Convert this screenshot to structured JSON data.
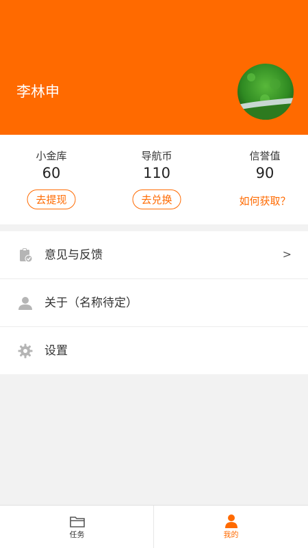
{
  "profile": {
    "name": "李林申"
  },
  "stats": [
    {
      "label": "小金库",
      "value": "60",
      "action": "去提现"
    },
    {
      "label": "导航币",
      "value": "110",
      "action": "去兑换"
    },
    {
      "label": "信誉值",
      "value": "90",
      "action": "如何获取？"
    }
  ],
  "menu": [
    {
      "label": "意见与反馈",
      "icon": "clipboard-icon",
      "arrow": ">"
    },
    {
      "label": "关于（名称待定）",
      "icon": "user-icon"
    },
    {
      "label": "设置",
      "icon": "gear-icon"
    }
  ],
  "tabbar": [
    {
      "label": "任务",
      "icon": "folder-icon",
      "active": false
    },
    {
      "label": "我的",
      "icon": "person-icon",
      "active": true
    }
  ],
  "colors": {
    "accent": "#ff6a00",
    "background": "#f2f2f2"
  }
}
